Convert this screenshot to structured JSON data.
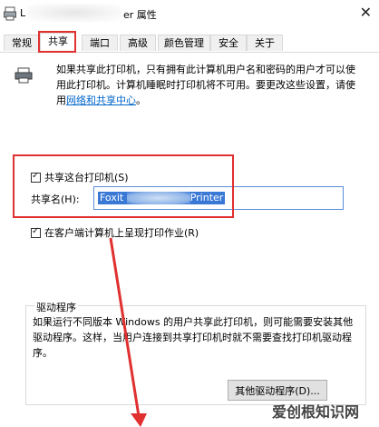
{
  "window": {
    "title_prefix": "L",
    "title_suffix": "er 属性",
    "close_glyph": "✕"
  },
  "tabs": [
    {
      "label": "常规",
      "active": false
    },
    {
      "label": "共享",
      "active": true
    },
    {
      "label": "端口",
      "active": false
    },
    {
      "label": "高级",
      "active": false
    },
    {
      "label": "颜色管理",
      "active": false
    },
    {
      "label": "安全",
      "active": false
    },
    {
      "label": "关于",
      "active": false
    }
  ],
  "info": {
    "text": "如果共享此打印机，只有拥有此计算机用户名和密码的用户才可以使用此打印机。计算机睡眠时打印机将不可用。要更改这些设置，请使用",
    "link": "网络和共享中心",
    "end": "。"
  },
  "share": {
    "checkbox_label": "共享这台打印机(S)",
    "checked": true,
    "name_label": "共享名(H):",
    "name_value_prefix": "Foxit",
    "name_value_suffix": "Printer"
  },
  "render_jobs": {
    "checkbox_label": "在客户端计算机上呈现打印作业(R)",
    "checked": true
  },
  "drivers": {
    "group_title": "驱动程序",
    "text": "如果运行不同版本 Windows 的用户共享此打印机，则可能需要安装其他驱动程序。这样，当用户连接到共享打印机时就不需要查找打印机驱动程序。",
    "button_label": "其他驱动程序(D)..."
  },
  "watermark": "爱创根知识网",
  "colors": {
    "highlight": "#e03030",
    "link": "#0066cc",
    "selection": "#3a78d6"
  }
}
